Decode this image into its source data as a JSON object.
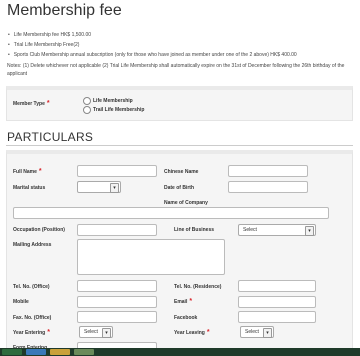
{
  "page": {
    "title": "Membership fee"
  },
  "fees": [
    "Life Membership fee HK$ 1,500.00",
    "Trial Life Membership Free(2)",
    "Sports Club Membership annual subscription (only for those who have joined as member under one of the 2 above) HK$ 400.00"
  ],
  "notes": "Notes: (1) Delete whichever not applicable (2) Trial Life Membership shall automatically expire on the 31st of December following the 26th birthday of the applicant",
  "member": {
    "label": "Member Type",
    "options": [
      "Life Membership",
      "Trail Life Membership"
    ]
  },
  "particulars": {
    "title": "PARTICULARS",
    "full_name": "Full Name",
    "chinese_name": "Chinese Name",
    "marital_status": "Marital status",
    "date_of_birth": "Date of Birth",
    "company_name": "Name of Company",
    "occupation": "Occupation (Position)",
    "line_of_business": "Line of Business",
    "line_of_business_value": "Select",
    "mailing_address": "Mailing Address",
    "tel_office": "Tel. No. (Office)",
    "tel_residence": "Tel. No. (Residence)",
    "mobile": "Mobile",
    "email": "Email",
    "fax_office": "Fax. No. (Office)",
    "facebook": "Facebook",
    "year_entering": "Year Entering",
    "year_entering_value": "Select",
    "year_leaving": "Year Leaving",
    "year_leaving_value": "Select",
    "form_entering": "Form Entering"
  },
  "colors": {
    "required": "#d9262c",
    "panel": "#f5f5f5",
    "taskbar": "#1f3a2a"
  }
}
